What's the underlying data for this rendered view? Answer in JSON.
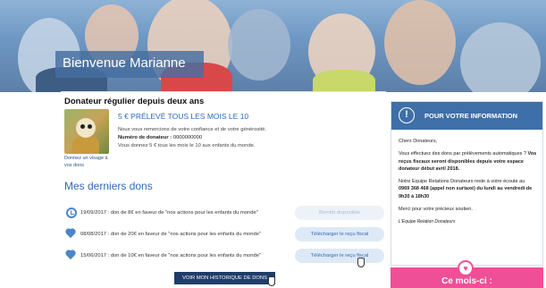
{
  "hero": {
    "title": "Bienvenue Marianne"
  },
  "donor": {
    "status": "Donateur régulier depuis deux ans",
    "image_caption": "Donnez un visage à vos dons",
    "headline": "5 € PRÉLEVÉ TOUS LES MOIS LE 10",
    "thanks": "Nous vous remercions de votre confiance et de votre générosité.",
    "number_label": "Numéro de donateur :",
    "number_value": "0000000000",
    "impact": "Vous donnez 5 € tous les mois le 10 aux enfants du monde."
  },
  "donations": {
    "title": "Mes derniers dons",
    "rows": [
      {
        "icon": "clock-icon",
        "text": "19/09/2017 : don de 8€ en faveur de \"nos actions pour les enfants du monde\"",
        "button": "Bientôt disponible",
        "button_enabled": false
      },
      {
        "icon": "heart-icon",
        "text": "08/08/2017 : don de 20€ en faveur de \"nos actions pour les enfants du monde\"",
        "button": "Télécharger le reçu fiscal",
        "button_enabled": true
      },
      {
        "icon": "heart-icon",
        "text": "15/06/2017 : don de 10€ en faveur de \"nos actions pour les enfants du monde\"",
        "button": "Télécharger le reçu fiscal",
        "button_enabled": true
      }
    ],
    "history_button": "VOIR MON HISTORIQUE DE DONS"
  },
  "info": {
    "icon": "exclamation-icon",
    "title": "POUR VOTRE INFORMATION",
    "greeting": "Chers Donateurs,",
    "paragraph1_start": "Vous effectuez des dons par prélèvements automatiques ? ",
    "paragraph1_strong": "Vos reçus fiscaux seront disponibles depuis votre espace donateur début avril 2018.",
    "paragraph2_start": "Notre Equipe Relations Donateurs reste à votre écoute au ",
    "paragraph2_strong": "0969 368 468 (appel non surtaxé) du lundi au vendredi de 9h30 à 18h30",
    "paragraph3": "Merci pour votre précieux soutien.",
    "signature": "L'Equipe Relation Donateurs"
  },
  "month": {
    "label": "Ce mois-ci :",
    "icon": "heart-icon"
  },
  "colors": {
    "accent_blue": "#2e6ab8",
    "header_blue": "#3f6fa8",
    "navy": "#1f3d6b",
    "pink": "#ef4f96"
  }
}
